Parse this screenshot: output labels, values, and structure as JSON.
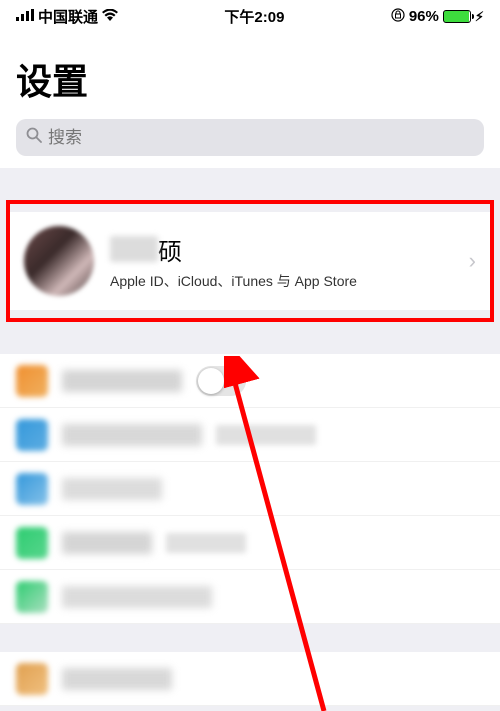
{
  "status": {
    "carrier": "中国联通",
    "time": "下午2:09",
    "battery": "96%"
  },
  "page": {
    "title": "设置",
    "search_placeholder": "搜索"
  },
  "profile": {
    "name_visible": "硕",
    "subtitle": "Apple ID、iCloud、iTunes 与 App Store"
  }
}
